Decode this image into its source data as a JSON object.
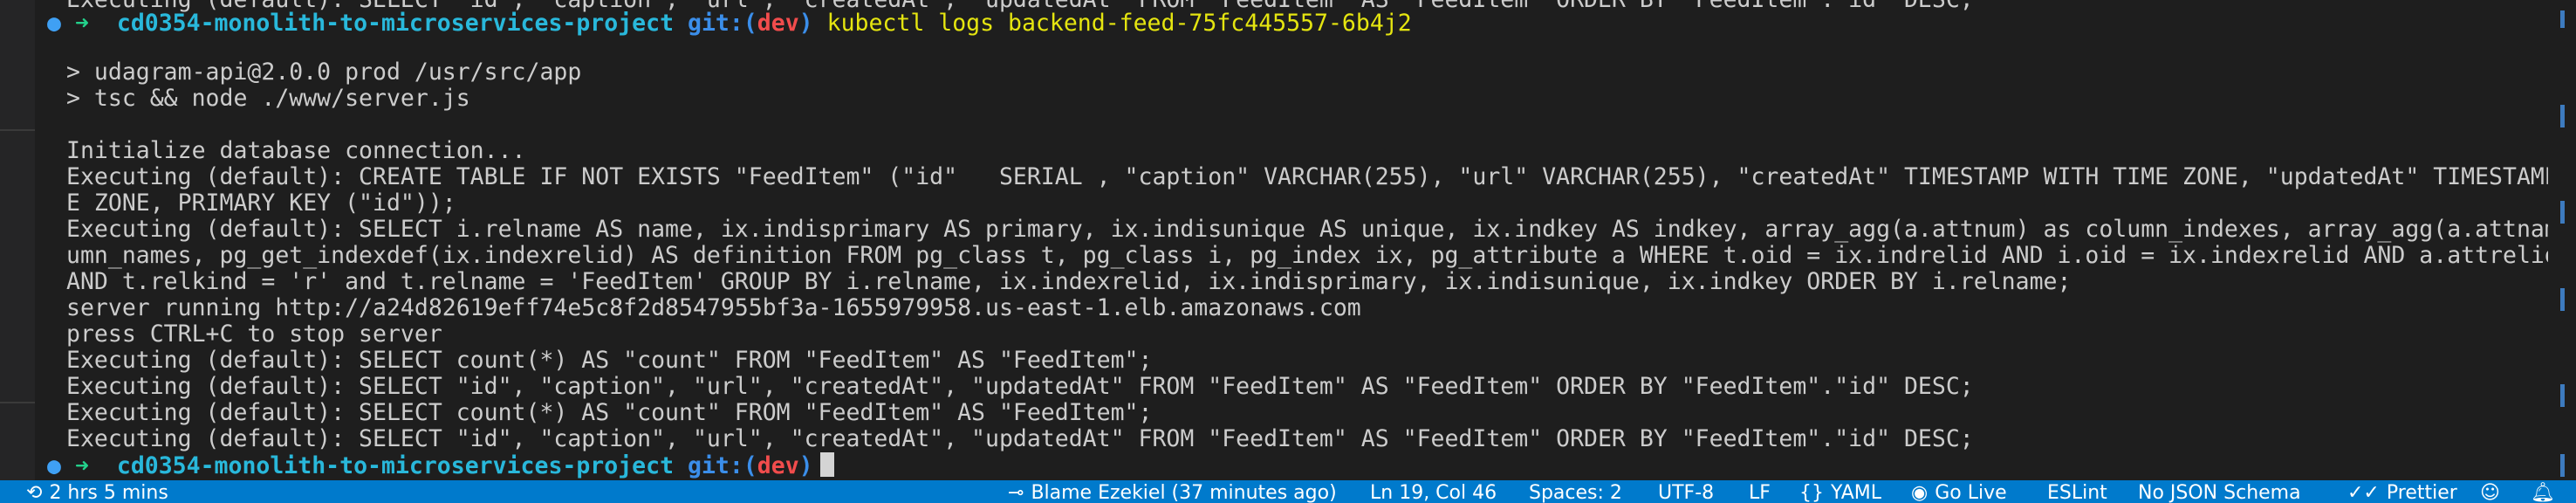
{
  "terminal": {
    "prompt": {
      "arrow": "➜",
      "directory": "cd0354-monolith-to-microservices-project",
      "git_label": "git:(",
      "branch": "dev",
      "git_close": ")"
    },
    "top_partial": "Executing (default): SELECT \"id\", \"caption\", \"url\", \"createdAt\", \"updatedAt\" FROM \"FeedItem\" AS \"FeedItem\" ORDER BY \"FeedItem\".\"id\" DESC;",
    "command": "kubectl logs backend-feed-75fc445557-6b4j2",
    "output_lines": [
      "> udagram-api@2.0.0 prod /usr/src/app",
      "> tsc && node ./www/server.js",
      "",
      "Initialize database connection...",
      "Executing (default): CREATE TABLE IF NOT EXISTS \"FeedItem\" (\"id\"   SERIAL , \"caption\" VARCHAR(255), \"url\" VARCHAR(255), \"createdAt\" TIMESTAMP WITH TIME ZONE, \"updatedAt\" TIMESTAMP WITH TIM",
      "E ZONE, PRIMARY KEY (\"id\"));",
      "Executing (default): SELECT i.relname AS name, ix.indisprimary AS primary, ix.indisunique AS unique, ix.indkey AS indkey, array_agg(a.attnum) as column_indexes, array_agg(a.attname) AS col",
      "umn_names, pg_get_indexdef(ix.indexrelid) AS definition FROM pg_class t, pg_class i, pg_index ix, pg_attribute a WHERE t.oid = ix.indrelid AND i.oid = ix.indexrelid AND a.attrelid = t.oid",
      "AND t.relkind = 'r' and t.relname = 'FeedItem' GROUP BY i.relname, ix.indexrelid, ix.indisprimary, ix.indisunique, ix.indkey ORDER BY i.relname;",
      "server running http://a24d82619eff74e5c8f2d8547955bf3a-1655979958.us-east-1.elb.amazonaws.com",
      "press CTRL+C to stop server",
      "Executing (default): SELECT count(*) AS \"count\" FROM \"FeedItem\" AS \"FeedItem\";",
      "Executing (default): SELECT \"id\", \"caption\", \"url\", \"createdAt\", \"updatedAt\" FROM \"FeedItem\" AS \"FeedItem\" ORDER BY \"FeedItem\".\"id\" DESC;",
      "Executing (default): SELECT count(*) AS \"count\" FROM \"FeedItem\" AS \"FeedItem\";",
      "Executing (default): SELECT \"id\", \"caption\", \"url\", \"createdAt\", \"updatedAt\" FROM \"FeedItem\" AS \"FeedItem\" ORDER BY \"FeedItem\".\"id\" DESC;"
    ]
  },
  "statusbar": {
    "left": {
      "time": "2 hrs 5 mins",
      "time_icon": "history-icon"
    },
    "right": {
      "blame": "Blame Ezekiel (37 minutes ago)",
      "cursor_position": "Ln 19, Col 46",
      "spaces": "Spaces: 2",
      "encoding": "UTF-8",
      "eol": "LF",
      "language": "YAML",
      "go_live": "Go Live",
      "eslint": "ESLint",
      "json_schema": "No JSON Schema",
      "prettier": "Prettier"
    }
  },
  "colors": {
    "accent": "#007acc",
    "prompt_arrow": "#23d18b",
    "directory": "#29b8db",
    "branch": "#f14c4c",
    "command": "#e5e510"
  }
}
